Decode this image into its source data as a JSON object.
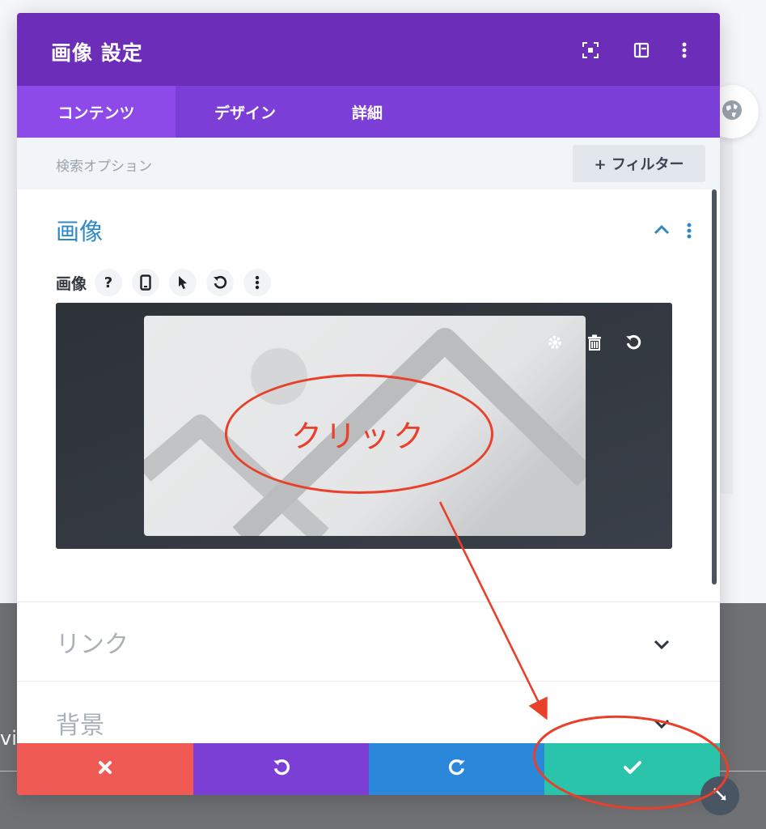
{
  "background": {
    "partial_text": "vi"
  },
  "modal": {
    "title": "画像 設定",
    "tabs": [
      {
        "label": "コンテンツ",
        "active": true
      },
      {
        "label": "デザイン",
        "active": false
      },
      {
        "label": "詳細",
        "active": false
      }
    ],
    "search": {
      "label": "検索オプション",
      "filter_button": "+ フィルター"
    },
    "section_image": {
      "title": "画像",
      "field_label": "画像",
      "help_glyph": "?"
    },
    "collapsed_sections": [
      {
        "label": "リンク"
      },
      {
        "label": "背景"
      }
    ]
  },
  "annotation": {
    "text": "クリック",
    "color": "#e8402a"
  },
  "colors": {
    "header": "#6c2eb9",
    "tabs": "#7b3ed6",
    "active_tab": "#8d4ae9",
    "section_title": "#2e89c6",
    "discard": "#ef5a55",
    "undo": "#7b3fd5",
    "redo": "#2b87da",
    "save": "#29c4a9"
  },
  "icons": {
    "header": [
      "expand-fullscreen-icon",
      "split-view-icon",
      "more-vertical-icon"
    ],
    "field_controls": [
      "help-icon",
      "mobile-device-icon",
      "pointer-hover-icon",
      "reset-icon",
      "more-vertical-icon"
    ],
    "image_tools": [
      "gear-icon",
      "trash-icon",
      "reset-icon"
    ],
    "footer": [
      "close-icon",
      "undo-icon",
      "redo-icon",
      "check-icon"
    ]
  }
}
